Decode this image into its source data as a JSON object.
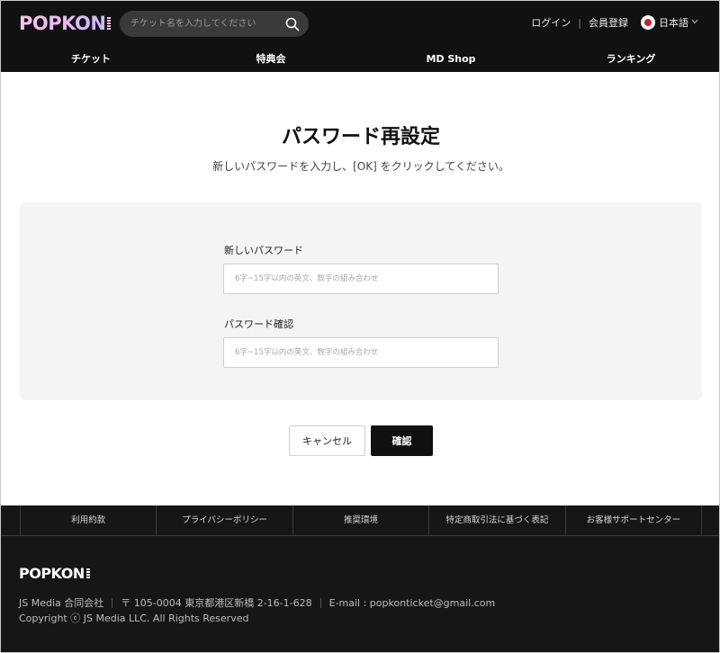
{
  "header": {
    "logo_text": "POPKON",
    "search_placeholder": "チケット名を入力してください",
    "login": "ログイン",
    "separator": "|",
    "register": "会員登録",
    "language": "日本語"
  },
  "nav": {
    "items": [
      "チケット",
      "特典会",
      "MD Shop",
      "ランキング"
    ]
  },
  "page": {
    "title": "パスワード再設定",
    "subtitle": "新しいパスワードを入力し、[OK] をクリックしてください。"
  },
  "form": {
    "new_password_label": "新しいパスワード",
    "new_password_placeholder": "6字~15字以内の英文、数字の組み合わせ",
    "confirm_password_label": "パスワード確認",
    "confirm_password_placeholder": "6字~15字以内の英文、数字の組み合わせ",
    "cancel_label": "キャンセル",
    "ok_label": "確認"
  },
  "footer": {
    "links": [
      "利用約款",
      "プライバシーポリシー",
      "推奨環境",
      "特定商取引法に基づく表記",
      "お客様サポートセンター"
    ],
    "logo_text": "POPKON",
    "company": "JS Media 合同会社",
    "address": "〒 105-0004 東京都港区新橋 2-16-1-628",
    "email": "E-mail : popkonticket@gmail.com",
    "copyright": "Copyright ⓒ JS Media LLC. All Rights Reserved"
  },
  "colors": {
    "header_bg": "#111111",
    "footer_bg": "#161616",
    "panel_bg": "#f3f4f4",
    "primary_button": "#111111",
    "flag_red": "#d11a2a"
  },
  "icons": [
    "search-icon",
    "japan-flag-icon",
    "chevron-down-icon"
  ]
}
